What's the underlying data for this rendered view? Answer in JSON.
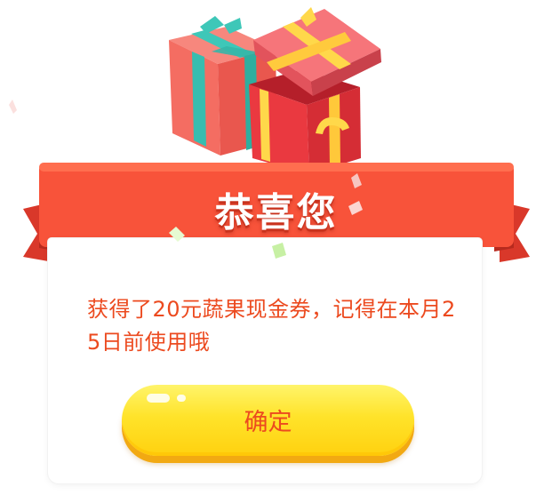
{
  "dialog": {
    "title": "恭喜您",
    "message": "获得了20元蔬果现金券，记得在本月25日前使用哦",
    "confirm_label": "确定"
  },
  "colors": {
    "banner": "#f8533a",
    "text": "#ec4a1f",
    "button": "#ffe12b",
    "gift_pink": "#f56c63",
    "gift_red": "#e8343c",
    "ribbon_teal": "#3ec7b8",
    "ribbon_yellow": "#ffd84a"
  },
  "icons": [
    "gift-box-icon",
    "gift-box-open-icon",
    "confetti-icon"
  ]
}
